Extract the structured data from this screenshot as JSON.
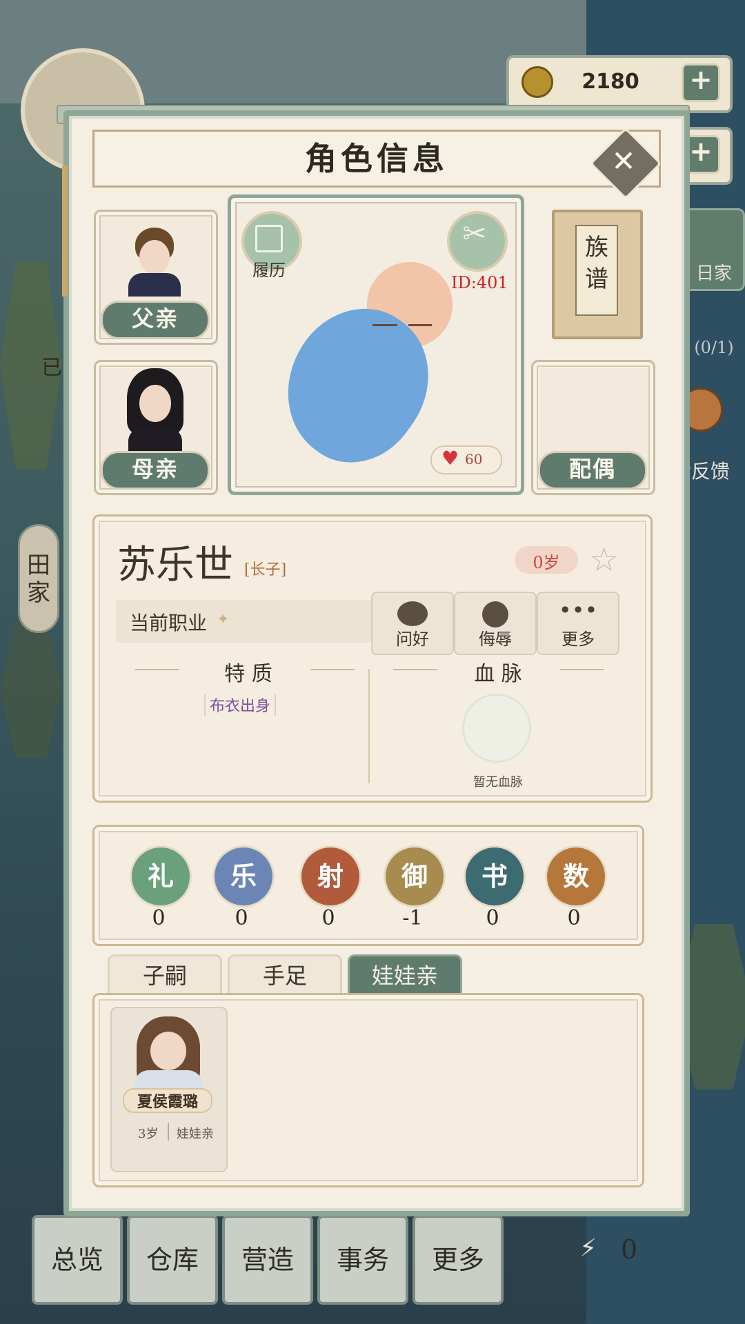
{
  "currency": {
    "coins": "2180"
  },
  "panel": {
    "title": "角色信息"
  },
  "family": {
    "father_label": "父亲",
    "mother_label": "母亲",
    "spouse_label": "配偶",
    "genealogy_label": "族谱"
  },
  "character": {
    "resume_label": "履历",
    "id_text": "ID:401",
    "favor_value": "60",
    "name": "苏乐世",
    "rank": "[长子]",
    "age": "0岁",
    "occupation_label": "当前职业",
    "traits_header": "特 质",
    "trait_1": "布衣出身",
    "bloodline_header": "血 脉",
    "no_bloodline": "暂无血脉"
  },
  "actions": {
    "greet": "问好",
    "insult": "侮辱",
    "more": "更多"
  },
  "stats": [
    {
      "name": "礼",
      "value": "0",
      "color": "#6aa07a"
    },
    {
      "name": "乐",
      "value": "0",
      "color": "#6b86b5"
    },
    {
      "name": "射",
      "value": "0",
      "color": "#b25a3c"
    },
    {
      "name": "御",
      "value": "-1",
      "color": "#a88b4e"
    },
    {
      "name": "书",
      "value": "0",
      "color": "#3d6b72"
    },
    {
      "name": "数",
      "value": "0",
      "color": "#b5783a"
    }
  ],
  "tabs": {
    "children": "子嗣",
    "siblings": "手足",
    "betrothed": "娃娃亲"
  },
  "betrothed_list": [
    {
      "name": "夏侯霞璐",
      "age": "3岁",
      "relation": "娃娃亲"
    }
  ],
  "background": {
    "side_label_top": "已",
    "side_label_clan": "田家",
    "map_label": "日家",
    "quest_count": "(0/1)",
    "feedback_label": "g反馈",
    "energy_value": "0",
    "bottom_nav": [
      "总览",
      "仓库",
      "营造",
      "事务",
      "更多"
    ]
  }
}
